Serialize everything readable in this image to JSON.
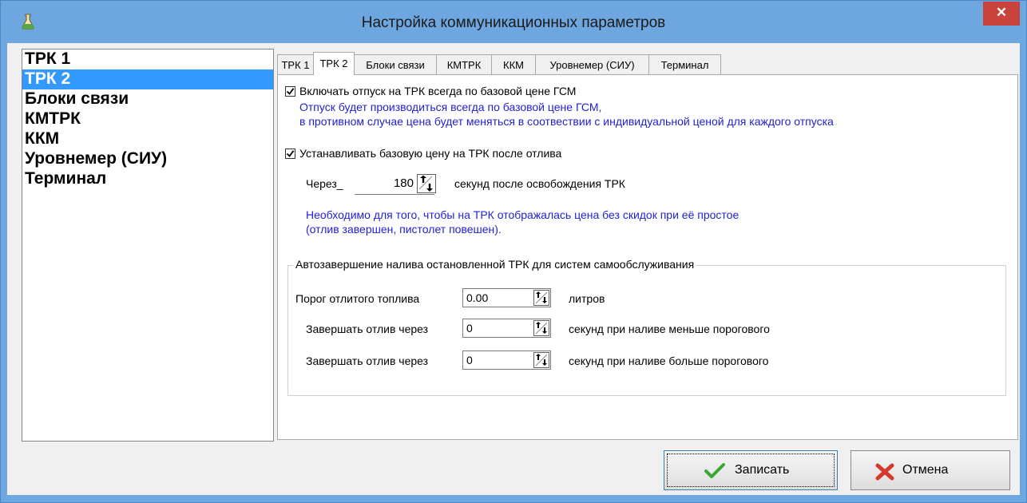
{
  "window": {
    "title": "Настройка коммуникационных параметров",
    "close_glyph": "✕"
  },
  "nav": {
    "items": [
      {
        "label": "ТРК 1",
        "selected": false
      },
      {
        "label": "ТРК 2",
        "selected": true
      },
      {
        "label": "Блоки связи",
        "selected": false
      },
      {
        "label": "КМТРК",
        "selected": false
      },
      {
        "label": "ККМ",
        "selected": false
      },
      {
        "label": "Уровнемер (СИУ)",
        "selected": false
      },
      {
        "label": "Терминал",
        "selected": false
      }
    ]
  },
  "tabs": [
    {
      "label": "ТРК 1",
      "active": false
    },
    {
      "label": "ТРК 2",
      "active": true
    },
    {
      "label": "Блоки связи",
      "active": false
    },
    {
      "label": "КМТРК",
      "active": false
    },
    {
      "label": "ККМ",
      "active": false
    },
    {
      "label": "Уровнемер (СИУ)",
      "active": false
    },
    {
      "label": "Терминал",
      "active": false
    }
  ],
  "panel": {
    "base_price_always": {
      "checked": true,
      "label": "Включать отпуск на ТРК всегда по базовой цене ГСМ",
      "note_line1": "Отпуск будет производиться всегда по базовой цене ГСМ,",
      "note_line2": "в противном случае цена будет меняться в соотвествии с индивидуальной ценой для каждого отпуска"
    },
    "set_base_price_after": {
      "checked": true,
      "label": "Устанавливать базовую цену на ТРК после отлива",
      "delay_prefix": "Через_",
      "delay_value": "180",
      "delay_suffix": "секунд после освобождения ТРК",
      "note_line1": "Необходимо для того, чтобы на ТРК отображалась цена без скидок при её простое",
      "note_line2": "(отлив завершен, пистолет повешен)."
    },
    "autocomplete_group": {
      "legend": "Автозавершение налива остановленной ТРК для систем самообслуживания",
      "threshold_label": "Порог отлитого топлива",
      "threshold_value": "0.00",
      "threshold_unit": "литров",
      "below_label": "Завершать отлив через",
      "below_value": "0",
      "below_suffix": "секунд при наливе меньше порогового",
      "above_label": "Завершать отлив через",
      "above_value": "0",
      "above_suffix": "секунд при наливе больше порогового"
    }
  },
  "buttons": {
    "save_label": "Записать",
    "cancel_label": "Отмена"
  },
  "icons": {
    "app": "flask-icon",
    "save": "checkmark-icon",
    "cancel": "x-icon",
    "spin": "spin-arrows-icon"
  },
  "colors": {
    "title_bar": "#6ea7e0",
    "selection": "#3399ff",
    "close_button": "#c7433b",
    "note_text": "#1f1fd6"
  }
}
